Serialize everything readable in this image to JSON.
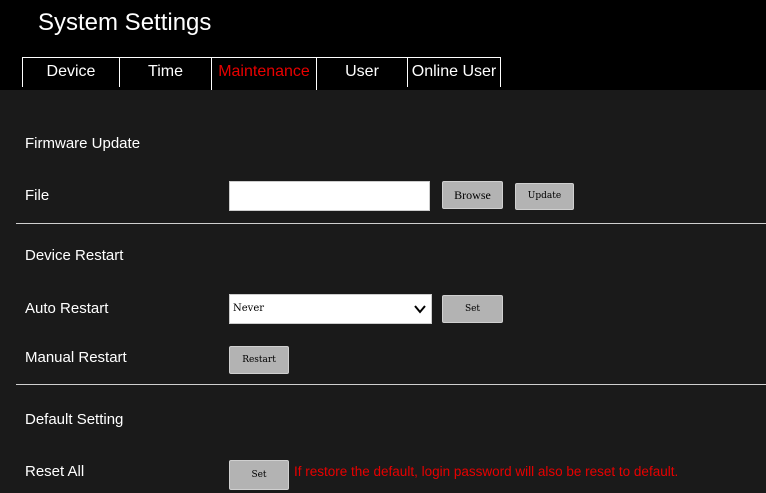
{
  "title": "System Settings",
  "tabs": [
    {
      "label": "Device",
      "active": false
    },
    {
      "label": "Time",
      "active": false
    },
    {
      "label": "Maintenance",
      "active": true
    },
    {
      "label": "User",
      "active": false
    },
    {
      "label": "Online User",
      "active": false
    }
  ],
  "firmware": {
    "section_title": "Firmware Update",
    "file_label": "File",
    "file_value": "",
    "browse_label": "Browse",
    "update_label": "Update"
  },
  "restart": {
    "section_title": "Device Restart",
    "auto_label": "Auto Restart",
    "auto_selected": "Never",
    "auto_set_label": "Set",
    "manual_label": "Manual Restart",
    "manual_button_label": "Restart"
  },
  "defaults": {
    "section_title": "Default Setting",
    "reset_label": "Reset All",
    "reset_button_label": "Set",
    "warning": "If restore the default, login password will also be reset to default."
  },
  "colors": {
    "background": "#1a1a1a",
    "header": "#000000",
    "accent_red": "#e80000",
    "button_gray": "#b3b3b3"
  }
}
